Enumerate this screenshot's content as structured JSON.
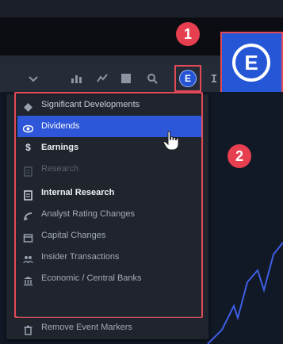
{
  "callouts": {
    "first": "1",
    "second": "2"
  },
  "toolbar": {
    "items": [
      {
        "icon": "chevron-down-icon"
      },
      {
        "icon": "bar-chart-icon"
      },
      {
        "icon": "indicator-icon"
      },
      {
        "icon": "grid-icon"
      },
      {
        "icon": "drawing-icon"
      },
      {
        "icon": "event-markers-icon",
        "label": "E",
        "active": true
      },
      {
        "icon": "more-icon"
      }
    ],
    "zoom_icon_label": "E"
  },
  "menu": {
    "items": [
      {
        "label": "Significant Developments",
        "icon": "diamond-icon",
        "state": "normal"
      },
      {
        "label": "Dividends",
        "icon": "eye-icon",
        "state": "selected"
      },
      {
        "label": "Earnings",
        "icon": "dollar-icon",
        "state": "bold"
      },
      {
        "label": "Research",
        "icon": "document-icon",
        "state": "disabled"
      },
      {
        "label": "Internal Research",
        "icon": "document-icon",
        "state": "bold"
      },
      {
        "label": "Analyst Rating Changes",
        "icon": "rating-icon",
        "state": "dim"
      },
      {
        "label": "Capital Changes",
        "icon": "capital-icon",
        "state": "dim"
      },
      {
        "label": "Insider Transactions",
        "icon": "insider-icon",
        "state": "dim"
      },
      {
        "label": "Economic / Central Banks",
        "icon": "bank-icon",
        "state": "dim"
      }
    ],
    "remove_label": "Remove Event Markers"
  },
  "colors": {
    "accent": "#2d56d8",
    "highlight": "#e34a57",
    "menu_bg": "#1f242d",
    "chart_line": "#3f5fe6"
  }
}
